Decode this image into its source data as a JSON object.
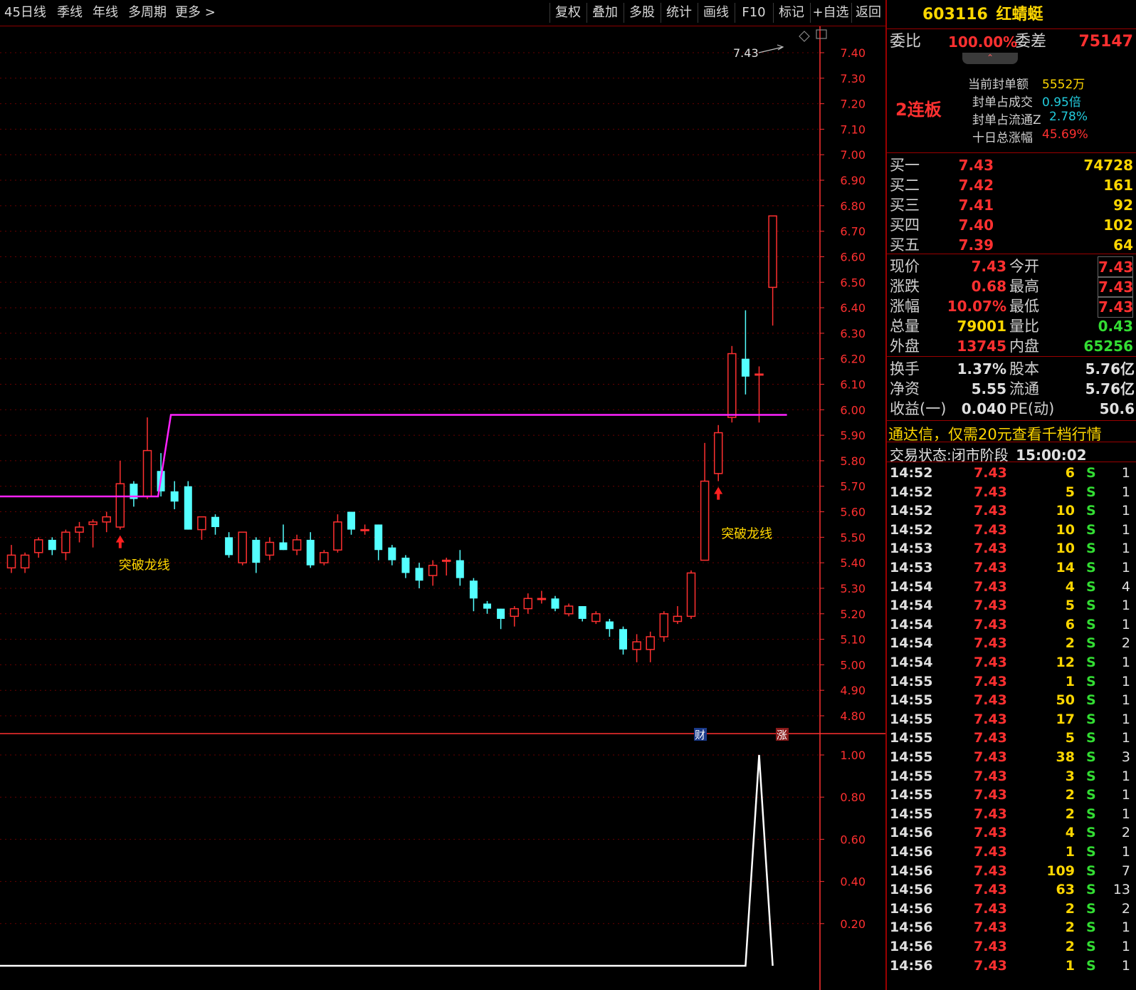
{
  "toolbar": {
    "left": [
      "45日线",
      "季线",
      "年线",
      "多周期",
      "更多 >"
    ],
    "right": [
      "复权",
      "叠加",
      "多股",
      "统计",
      "画线",
      "F10",
      "标记",
      "+自选",
      "返回"
    ]
  },
  "chart_data": [
    {
      "type": "candlestick",
      "yticks": [
        "7.40",
        "7.30",
        "7.20",
        "7.10",
        "7.00",
        "6.90",
        "6.80",
        "6.70",
        "6.60",
        "6.50",
        "6.40",
        "6.30",
        "6.20",
        "6.10",
        "6.00",
        "5.90",
        "5.80",
        "5.70",
        "5.60",
        "5.50",
        "5.40",
        "5.30",
        "5.20",
        "5.10",
        "5.00",
        "4.90",
        "4.80"
      ],
      "ylim": [
        4.73,
        7.47
      ],
      "candles": [
        {
          "o": 5.38,
          "h": 5.47,
          "l": 5.36,
          "c": 5.43
        },
        {
          "o": 5.38,
          "h": 5.44,
          "l": 5.36,
          "c": 5.43
        },
        {
          "o": 5.44,
          "h": 5.5,
          "l": 5.42,
          "c": 5.49
        },
        {
          "o": 5.49,
          "h": 5.5,
          "l": 5.43,
          "c": 5.45
        },
        {
          "o": 5.44,
          "h": 5.53,
          "l": 5.41,
          "c": 5.52
        },
        {
          "o": 5.52,
          "h": 5.56,
          "l": 5.48,
          "c": 5.54
        },
        {
          "o": 5.55,
          "h": 5.57,
          "l": 5.46,
          "c": 5.56
        },
        {
          "o": 5.56,
          "h": 5.6,
          "l": 5.52,
          "c": 5.58
        },
        {
          "o": 5.54,
          "h": 5.8,
          "l": 5.53,
          "c": 5.71
        },
        {
          "o": 5.71,
          "h": 5.72,
          "l": 5.62,
          "c": 5.65
        },
        {
          "o": 5.66,
          "h": 5.97,
          "l": 5.65,
          "c": 5.84
        },
        {
          "o": 5.76,
          "h": 5.83,
          "l": 5.66,
          "c": 5.68
        },
        {
          "o": 5.68,
          "h": 5.72,
          "l": 5.61,
          "c": 5.64
        },
        {
          "o": 5.7,
          "h": 5.72,
          "l": 5.53,
          "c": 5.53
        },
        {
          "o": 5.53,
          "h": 5.58,
          "l": 5.49,
          "c": 5.58
        },
        {
          "o": 5.58,
          "h": 5.59,
          "l": 5.51,
          "c": 5.54
        },
        {
          "o": 5.5,
          "h": 5.52,
          "l": 5.42,
          "c": 5.43
        },
        {
          "o": 5.4,
          "h": 5.52,
          "l": 5.39,
          "c": 5.52
        },
        {
          "o": 5.49,
          "h": 5.5,
          "l": 5.36,
          "c": 5.4
        },
        {
          "o": 5.43,
          "h": 5.5,
          "l": 5.41,
          "c": 5.48
        },
        {
          "o": 5.48,
          "h": 5.55,
          "l": 5.45,
          "c": 5.45
        },
        {
          "o": 5.45,
          "h": 5.51,
          "l": 5.43,
          "c": 5.49
        },
        {
          "o": 5.49,
          "h": 5.52,
          "l": 5.38,
          "c": 5.39
        },
        {
          "o": 5.4,
          "h": 5.45,
          "l": 5.39,
          "c": 5.44
        },
        {
          "o": 5.45,
          "h": 5.59,
          "l": 5.44,
          "c": 5.56
        },
        {
          "o": 5.6,
          "h": 5.6,
          "l": 5.51,
          "c": 5.53
        },
        {
          "o": 5.53,
          "h": 5.55,
          "l": 5.51,
          "c": 5.53
        },
        {
          "o": 5.55,
          "h": 5.55,
          "l": 5.41,
          "c": 5.45
        },
        {
          "o": 5.46,
          "h": 5.47,
          "l": 5.39,
          "c": 5.41
        },
        {
          "o": 5.42,
          "h": 5.43,
          "l": 5.34,
          "c": 5.36
        },
        {
          "o": 5.38,
          "h": 5.4,
          "l": 5.3,
          "c": 5.33
        },
        {
          "o": 5.35,
          "h": 5.41,
          "l": 5.31,
          "c": 5.39
        },
        {
          "o": 5.41,
          "h": 5.42,
          "l": 5.35,
          "c": 5.41
        },
        {
          "o": 5.41,
          "h": 5.45,
          "l": 5.31,
          "c": 5.34
        },
        {
          "o": 5.33,
          "h": 5.34,
          "l": 5.21,
          "c": 5.26
        },
        {
          "o": 5.24,
          "h": 5.25,
          "l": 5.2,
          "c": 5.22
        },
        {
          "o": 5.22,
          "h": 5.22,
          "l": 5.14,
          "c": 5.18
        },
        {
          "o": 5.19,
          "h": 5.23,
          "l": 5.15,
          "c": 5.22
        },
        {
          "o": 5.22,
          "h": 5.28,
          "l": 5.2,
          "c": 5.26
        },
        {
          "o": 5.26,
          "h": 5.29,
          "l": 5.24,
          "c": 5.26
        },
        {
          "o": 5.26,
          "h": 5.27,
          "l": 5.21,
          "c": 5.22
        },
        {
          "o": 5.2,
          "h": 5.24,
          "l": 5.19,
          "c": 5.23
        },
        {
          "o": 5.23,
          "h": 5.23,
          "l": 5.17,
          "c": 5.18
        },
        {
          "o": 5.17,
          "h": 5.21,
          "l": 5.16,
          "c": 5.2
        },
        {
          "o": 5.17,
          "h": 5.18,
          "l": 5.11,
          "c": 5.14
        },
        {
          "o": 5.14,
          "h": 5.15,
          "l": 5.04,
          "c": 5.06
        },
        {
          "o": 5.06,
          "h": 5.12,
          "l": 5.01,
          "c": 5.09
        },
        {
          "o": 5.06,
          "h": 5.13,
          "l": 5.01,
          "c": 5.11
        },
        {
          "o": 5.11,
          "h": 5.21,
          "l": 5.09,
          "c": 5.2
        },
        {
          "o": 5.17,
          "h": 5.23,
          "l": 5.16,
          "c": 5.19
        },
        {
          "o": 5.19,
          "h": 5.37,
          "l": 5.18,
          "c": 5.36
        },
        {
          "o": 5.41,
          "h": 5.87,
          "l": 5.41,
          "c": 5.72
        },
        {
          "o": 5.75,
          "h": 5.94,
          "l": 5.72,
          "c": 5.91
        },
        {
          "o": 5.97,
          "h": 6.25,
          "l": 5.95,
          "c": 6.22
        },
        {
          "o": 6.2,
          "h": 6.39,
          "l": 6.06,
          "c": 6.13
        },
        {
          "o": 6.14,
          "h": 6.17,
          "l": 5.95,
          "c": 6.14
        },
        {
          "o": 6.48,
          "h": 6.76,
          "l": 6.33,
          "c": 6.76
        }
      ],
      "dragon_line": {
        "before": 5.66,
        "after": 5.98,
        "switch_index": 11
      },
      "price_label": "7.43",
      "annotations": [
        {
          "text": "突破龙线",
          "index": 8
        },
        {
          "text": "突破龙线",
          "index": 52
        }
      ],
      "markers": {
        "cai": "财",
        "zhang": "涨"
      }
    },
    {
      "type": "line",
      "yticks": [
        "1.00",
        "0.80",
        "0.60",
        "0.40",
        "0.20"
      ],
      "ylim": [
        0,
        1.0
      ],
      "values": [
        0,
        0,
        0,
        0,
        0,
        0,
        0,
        0,
        0,
        0,
        0,
        0,
        0,
        0,
        0,
        0,
        0,
        0,
        0,
        0,
        0,
        0,
        0,
        0,
        0,
        0,
        0,
        0,
        0,
        0,
        0,
        0,
        0,
        0,
        0,
        0,
        0,
        0,
        0,
        0,
        0,
        0,
        0,
        0,
        0,
        0,
        0,
        0,
        0,
        0,
        0,
        0,
        0,
        0,
        0,
        1,
        0
      ]
    }
  ],
  "panel": {
    "code": "603116",
    "name": "红蜻蜓",
    "weibi_label": "委比",
    "weibi": "100.00%",
    "weicha_label": "委差",
    "weicha": "75147",
    "lianban": "2连板",
    "seal_info": [
      {
        "label": "当前封单额",
        "value": "5552万",
        "color": "yellow"
      },
      {
        "label": "封单占成交",
        "value": "0.95倍",
        "color": "cyan"
      },
      {
        "label": "封单占流通Z",
        "value": "2.78%",
        "color": "cyan"
      },
      {
        "label": "十日总涨幅",
        "value": "45.69%",
        "color": "red"
      }
    ],
    "bids": [
      {
        "label": "买一",
        "price": "7.43",
        "vol": "74728"
      },
      {
        "label": "买二",
        "price": "7.42",
        "vol": "161"
      },
      {
        "label": "买三",
        "price": "7.41",
        "vol": "92"
      },
      {
        "label": "买四",
        "price": "7.40",
        "vol": "102"
      },
      {
        "label": "买五",
        "price": "7.39",
        "vol": "64"
      }
    ],
    "quote": [
      {
        "l1": "现价",
        "v1": "7.43",
        "c1": "red",
        "l2": "今开",
        "v2": "7.43",
        "c2": "red"
      },
      {
        "l1": "涨跌",
        "v1": "0.68",
        "c1": "red",
        "l2": "最高",
        "v2": "7.43",
        "c2": "red"
      },
      {
        "l1": "涨幅",
        "v1": "10.07%",
        "c1": "red",
        "l2": "最低",
        "v2": "7.43",
        "c2": "red"
      },
      {
        "l1": "总量",
        "v1": "79001",
        "c1": "yellow",
        "l2": "量比",
        "v2": "0.43",
        "c2": "green"
      },
      {
        "l1": "外盘",
        "v1": "13745",
        "c1": "red",
        "l2": "内盘",
        "v2": "65256",
        "c2": "green"
      }
    ],
    "fund": [
      {
        "l1": "换手",
        "v1": "1.37%",
        "l2": "股本",
        "v2": "5.76亿"
      },
      {
        "l1": "净资",
        "v1": "5.55",
        "l2": "流通",
        "v2": "5.76亿"
      },
      {
        "l1": "收益(一)",
        "v1": "0.040",
        "l2": "PE(动)",
        "v2": "50.6"
      }
    ],
    "promo": "通达信，仅需20元查看千档行情",
    "status_label": "交易状态:",
    "status": "闭市阶段",
    "status_time": "15:00:02",
    "trades": [
      {
        "t": "14:52",
        "p": "7.43",
        "v": "6",
        "s": "S",
        "n": "1"
      },
      {
        "t": "14:52",
        "p": "7.43",
        "v": "5",
        "s": "S",
        "n": "1"
      },
      {
        "t": "14:52",
        "p": "7.43",
        "v": "10",
        "s": "S",
        "n": "1"
      },
      {
        "t": "14:52",
        "p": "7.43",
        "v": "10",
        "s": "S",
        "n": "1"
      },
      {
        "t": "14:53",
        "p": "7.43",
        "v": "10",
        "s": "S",
        "n": "1"
      },
      {
        "t": "14:53",
        "p": "7.43",
        "v": "14",
        "s": "S",
        "n": "1"
      },
      {
        "t": "14:54",
        "p": "7.43",
        "v": "4",
        "s": "S",
        "n": "4"
      },
      {
        "t": "14:54",
        "p": "7.43",
        "v": "5",
        "s": "S",
        "n": "1"
      },
      {
        "t": "14:54",
        "p": "7.43",
        "v": "6",
        "s": "S",
        "n": "1"
      },
      {
        "t": "14:54",
        "p": "7.43",
        "v": "2",
        "s": "S",
        "n": "2"
      },
      {
        "t": "14:54",
        "p": "7.43",
        "v": "12",
        "s": "S",
        "n": "1"
      },
      {
        "t": "14:55",
        "p": "7.43",
        "v": "1",
        "s": "S",
        "n": "1"
      },
      {
        "t": "14:55",
        "p": "7.43",
        "v": "50",
        "s": "S",
        "n": "1"
      },
      {
        "t": "14:55",
        "p": "7.43",
        "v": "17",
        "s": "S",
        "n": "1"
      },
      {
        "t": "14:55",
        "p": "7.43",
        "v": "5",
        "s": "S",
        "n": "1"
      },
      {
        "t": "14:55",
        "p": "7.43",
        "v": "38",
        "s": "S",
        "n": "3"
      },
      {
        "t": "14:55",
        "p": "7.43",
        "v": "3",
        "s": "S",
        "n": "1"
      },
      {
        "t": "14:55",
        "p": "7.43",
        "v": "2",
        "s": "S",
        "n": "1"
      },
      {
        "t": "14:55",
        "p": "7.43",
        "v": "2",
        "s": "S",
        "n": "1"
      },
      {
        "t": "14:56",
        "p": "7.43",
        "v": "4",
        "s": "S",
        "n": "2"
      },
      {
        "t": "14:56",
        "p": "7.43",
        "v": "1",
        "s": "S",
        "n": "1"
      },
      {
        "t": "14:56",
        "p": "7.43",
        "v": "109",
        "s": "S",
        "n": "7"
      },
      {
        "t": "14:56",
        "p": "7.43",
        "v": "63",
        "s": "S",
        "n": "13"
      },
      {
        "t": "14:56",
        "p": "7.43",
        "v": "2",
        "s": "S",
        "n": "2"
      },
      {
        "t": "14:56",
        "p": "7.43",
        "v": "2",
        "s": "S",
        "n": "1"
      },
      {
        "t": "14:56",
        "p": "7.43",
        "v": "2",
        "s": "S",
        "n": "1"
      },
      {
        "t": "14:56",
        "p": "7.43",
        "v": "1",
        "s": "S",
        "n": "1"
      }
    ]
  },
  "colors": {
    "up": "#ff3030",
    "down": "#54ffff",
    "dragon": "#ff22ff",
    "grid": "#6a0000",
    "axis": "#ff3030"
  }
}
